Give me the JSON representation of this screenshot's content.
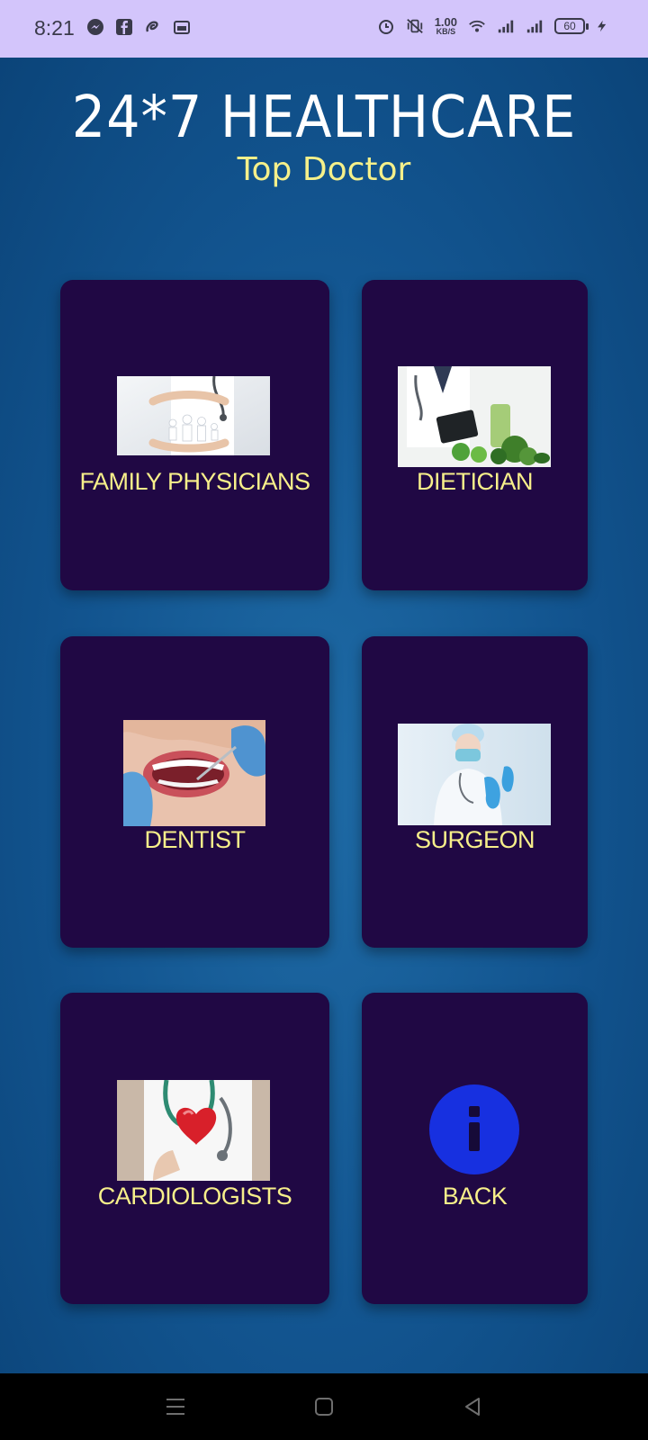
{
  "status_bar": {
    "time": "8:21",
    "left_icons": [
      "messenger-icon",
      "facebook-icon",
      "airtel-icon",
      "screenshot-icon"
    ],
    "net_speed_value": "1.00",
    "net_speed_unit": "KB/S",
    "battery_level": "60"
  },
  "header": {
    "title": "24*7 HEALTHCARE",
    "subtitle": "Top Doctor"
  },
  "cards": [
    {
      "label": "FAMILY PHYSICIANS",
      "image": "family-care-photo"
    },
    {
      "label": "DIETICIAN",
      "image": "dietician-photo"
    },
    {
      "label": "DENTIST",
      "image": "dentist-photo"
    },
    {
      "label": "SURGEON",
      "image": "surgeon-photo"
    },
    {
      "label": "CARDIOLOGISTS",
      "image": "cardiologist-photo"
    },
    {
      "label": "BACK",
      "image": "info-icon"
    }
  ],
  "colors": {
    "background": "#12548f",
    "card": "#200844",
    "label": "#f7ef8a",
    "status_bar": "#d3c5fb",
    "info_icon": "#1730e0"
  }
}
